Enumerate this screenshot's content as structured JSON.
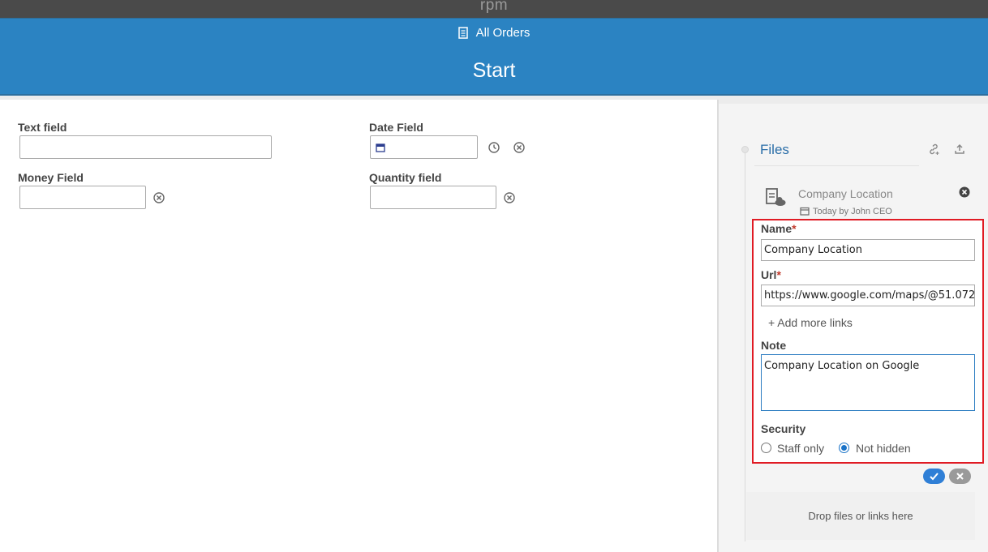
{
  "app": {
    "logo": "rpm"
  },
  "header": {
    "breadcrumb": "All Orders",
    "title": "Start"
  },
  "form": {
    "text_field_label": "Text field",
    "money_field_label": "Money Field",
    "date_field_label": "Date Field",
    "quantity_field_label": "Quantity field"
  },
  "files": {
    "title": "Files",
    "item": {
      "name": "Company Location",
      "date": "Today",
      "author": "by John CEO"
    },
    "edit": {
      "name_label": "Name",
      "name_value": "Company Location",
      "url_label": "Url",
      "url_value": "https://www.google.com/maps/@51.072",
      "add_links": "+ Add more links",
      "note_label": "Note",
      "note_value": "Company Location on Google",
      "security_label": "Security",
      "security_options": [
        "Staff only",
        "Not hidden"
      ],
      "security_selected": "Not hidden",
      "required_mark": "*"
    },
    "drop_text": "Drop files or links here"
  },
  "colors": {
    "header": "#2b83c2",
    "topbar": "#4a4a4a",
    "highlight": "#e01b24",
    "accent": "#2f7fd6"
  },
  "icons": [
    "document-icon",
    "calendar-icon",
    "clock-icon",
    "clear-icon",
    "link-icon",
    "upload-icon",
    "file-cloud-icon",
    "close-icon",
    "check-icon"
  ]
}
